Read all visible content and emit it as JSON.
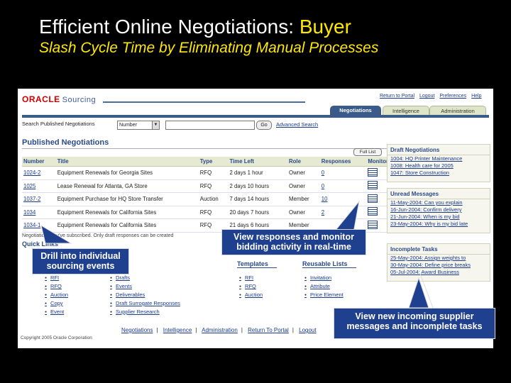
{
  "slide": {
    "title_main": "Efficient Online Negotiations: ",
    "title_highlight": "Buyer",
    "subtitle": "Slash Cycle Time by Eliminating Manual Processes"
  },
  "app": {
    "logo": "ORACLE",
    "suite": "Sourcing",
    "top_links": [
      "Return to Portal",
      "Logout",
      "Preferences",
      "Help"
    ],
    "tabs": [
      "Negotiations",
      "Intelligence",
      "Administration"
    ],
    "active_tab": "Negotiations"
  },
  "search": {
    "label": "Search Published Negotiations",
    "select_value": "Number",
    "go_label": "Go",
    "advanced_label": "Advanced Search"
  },
  "published": {
    "heading": "Published Negotiations",
    "full_list_label": "Full List",
    "columns": [
      "Number",
      "Title",
      "Type",
      "Time Left",
      "Role",
      "Responses",
      "Monitor"
    ],
    "rows": [
      {
        "number": "1024-2",
        "title": "Equipment Renewals for Georgia Sites",
        "type": "RFQ",
        "time_left": "2 days 1 hour",
        "role": "Owner",
        "responses": "0"
      },
      {
        "number": "1025",
        "title": "Lease Renewal for Atlanta, GA Store",
        "type": "RFQ",
        "time_left": "2 days 10 hours",
        "role": "Owner",
        "responses": "0"
      },
      {
        "number": "1037-2",
        "title": "Equipment Purchase for HQ Store Transfer",
        "type": "Auction",
        "time_left": "7 days 14 hours",
        "role": "Member",
        "responses": "10"
      },
      {
        "number": "1034",
        "title": "Equipment Renewals for California Sites",
        "type": "RFQ",
        "time_left": "20 days 7 hours",
        "role": "Owner",
        "responses": "2"
      },
      {
        "number": "1034-1",
        "title": "Equipment Renewals for California Sites",
        "type": "RFQ",
        "time_left": "21 days 6 hours",
        "role": "Member",
        "responses": ""
      }
    ],
    "footnote": "Negotiations you've subscribed. Only draft responses can be created",
    "quick_label": "Quick Links"
  },
  "right_panel": {
    "draft": {
      "heading": "Draft Negotiations",
      "items": [
        "1004: HQ Printer Maintenance",
        "1008: Health care for 2005",
        "1047: Store Construction"
      ]
    },
    "messages": {
      "heading": "Unread Messages",
      "items": [
        "11-May-2004: Can you explain",
        "16-Jun-2004: Confirm delivery",
        "21-Jun-2004: When is my bid",
        "23-May-2004: Why is my bid late"
      ]
    },
    "tasks": {
      "heading": "Incomplete Tasks",
      "items": [
        "25-May-2004: Assign weights to",
        "30-May-2004: Define price breaks",
        "05-Jul-2004: Award Business"
      ]
    }
  },
  "quick_links": {
    "create_items": [
      "RFI",
      "RFQ",
      "Auction",
      "Copy",
      "Event"
    ],
    "manage_items": [
      "Drafts",
      "Events",
      "Deliverables",
      "Draft Surrogate Responses",
      "Supplier Research"
    ],
    "templates_heading": "Templates",
    "templates_items": [
      "RFI",
      "RFQ",
      "Auction"
    ],
    "lists_heading": "Reusable Lists",
    "lists_items": [
      "Invitation",
      "Attribute",
      "Price Element"
    ]
  },
  "bottom_nav": [
    "Negotiations",
    "Intelligence",
    "Administration",
    "Return To Portal",
    "Logout"
  ],
  "copyright": "Copyright 2005 Oracle Corporation",
  "callouts": {
    "drill": "Drill into individual sourcing events",
    "view": "View responses and monitor bidding activity in real-time",
    "incoming": "View new incoming supplier messages and incomplete tasks"
  },
  "colors": {
    "callout_bg": "#1f3f8f",
    "title_highlight": "#ffe800",
    "tab_active": "#3a5a8a",
    "oracle_red": "#cc0000"
  }
}
